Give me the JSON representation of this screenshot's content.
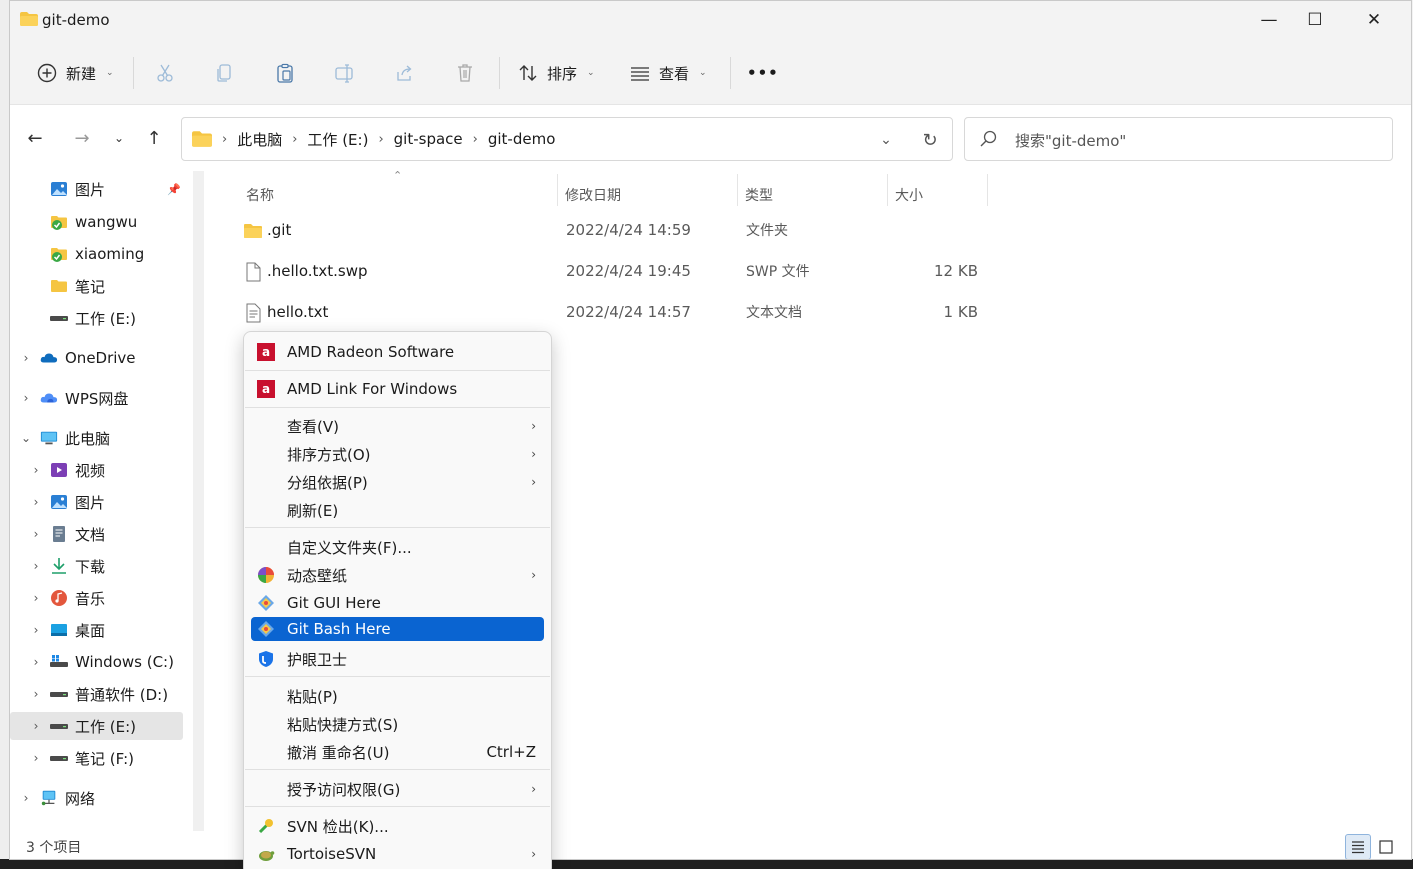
{
  "window": {
    "title": "git-demo",
    "minimize": "—",
    "maximize": "☐",
    "close": "✕"
  },
  "toolbar": {
    "new_label": "新建",
    "sort_label": "排序",
    "view_label": "查看",
    "more_label": "•••"
  },
  "address": {
    "crumbs": [
      "此电脑",
      "工作 (E:)",
      "git-space",
      "git-demo"
    ]
  },
  "search": {
    "placeholder": "搜索\"git-demo\""
  },
  "sidebar": {
    "items": [
      {
        "label": "图片",
        "icon": "pictures-icon"
      },
      {
        "label": "wangwu",
        "icon": "folder-sync-icon"
      },
      {
        "label": "xiaoming",
        "icon": "folder-sync-icon"
      },
      {
        "label": "笔记",
        "icon": "folder-icon"
      },
      {
        "label": "工作 (E:)",
        "icon": "drive-icon"
      },
      {
        "label": "OneDrive",
        "icon": "onedrive-icon"
      },
      {
        "label": "WPS网盘",
        "icon": "cloud-icon"
      },
      {
        "label": "此电脑",
        "icon": "computer-icon"
      },
      {
        "label": "视频",
        "icon": "video-icon"
      },
      {
        "label": "图片",
        "icon": "pictures-icon"
      },
      {
        "label": "文档",
        "icon": "document-icon"
      },
      {
        "label": "下载",
        "icon": "download-icon"
      },
      {
        "label": "音乐",
        "icon": "music-icon"
      },
      {
        "label": "桌面",
        "icon": "desktop-icon"
      },
      {
        "label": "Windows (C:)",
        "icon": "windows-drive-icon"
      },
      {
        "label": "普通软件 (D:)",
        "icon": "drive-icon"
      },
      {
        "label": "工作 (E:)",
        "icon": "drive-icon"
      },
      {
        "label": "笔记 (F:)",
        "icon": "drive-icon"
      },
      {
        "label": "网络",
        "icon": "network-icon"
      }
    ]
  },
  "columns": {
    "name": "名称",
    "date": "修改日期",
    "type": "类型",
    "size": "大小"
  },
  "files": [
    {
      "name": ".git",
      "date": "2022/4/24 14:59",
      "type": "文件夹",
      "size": ""
    },
    {
      "name": ".hello.txt.swp",
      "date": "2022/4/24 19:45",
      "type": "SWP 文件",
      "size": "12 KB"
    },
    {
      "name": "hello.txt",
      "date": "2022/4/24 14:57",
      "type": "文本文档",
      "size": "1 KB"
    }
  ],
  "status": {
    "count": "3 个项目"
  },
  "context_menu": {
    "amd_radeon": "AMD Radeon Software",
    "amd_link": "AMD Link For Windows",
    "view": "查看(V)",
    "sort_by": "排序方式(O)",
    "group_by": "分组依据(P)",
    "refresh": "刷新(E)",
    "customize": "自定义文件夹(F)...",
    "wallpaper": "动态壁纸",
    "git_gui": "Git GUI Here",
    "git_bash": "Git Bash Here",
    "eye_guard": "护眼卫士",
    "paste": "粘贴(P)",
    "paste_shortcut": "粘贴快捷方式(S)",
    "undo_rename": "撤消 重命名(U)",
    "undo_shortcut": "Ctrl+Z",
    "grant_access": "授予访问权限(G)",
    "svn_checkout": "SVN 检出(K)...",
    "tortoise": "TortoiseSVN"
  },
  "colors": {
    "accent": "#0a64d1",
    "folder": "#f5c542"
  }
}
